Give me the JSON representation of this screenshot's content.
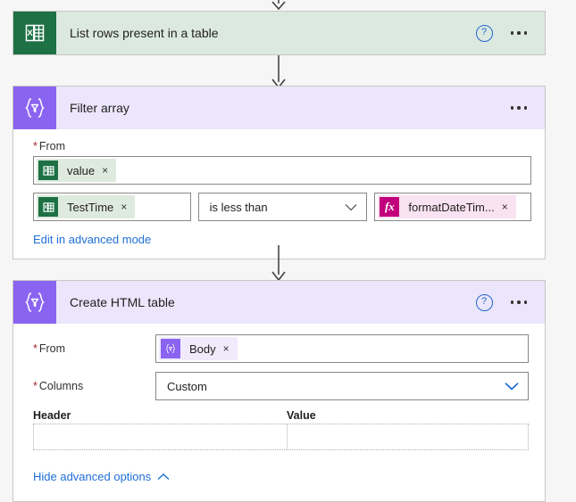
{
  "flow": {
    "connectors": [
      {
        "name": "connector-top"
      },
      {
        "name": "connector-excel-to-filter"
      },
      {
        "name": "connector-filter-to-table"
      }
    ],
    "steps": [
      {
        "id": "list-rows",
        "title": "List rows present in a table",
        "icon": "excel-icon",
        "theme": "green",
        "has_help": true,
        "has_menu": true
      },
      {
        "id": "filter-array",
        "title": "Filter array",
        "icon": "filter-array-icon",
        "theme": "purple",
        "has_help": false,
        "has_menu": true,
        "from_label": "From",
        "from_token": {
          "label": "value",
          "icon": "excel-icon",
          "remove": "×"
        },
        "condition": {
          "left_token": {
            "label": "TestTime",
            "icon": "excel-icon",
            "remove": "×"
          },
          "operator": "is less than",
          "right_token": {
            "label": "formatDateTim...",
            "icon": "function-icon",
            "remove": "×"
          }
        },
        "advanced_link": "Edit in advanced mode"
      },
      {
        "id": "create-html-table",
        "title": "Create HTML table",
        "icon": "create-html-table-icon",
        "theme": "purple",
        "has_help": true,
        "has_menu": true,
        "from_label": "From",
        "from_token": {
          "label": "Body",
          "icon": "filter-array-icon",
          "remove": "×"
        },
        "columns_label": "Columns",
        "columns_value": "Custom",
        "header_column_label": "Header",
        "value_column_label": "Value",
        "header_input_value": "",
        "value_input_value": "",
        "advanced_link": "Hide advanced options"
      }
    ]
  },
  "icons": {
    "help": "?",
    "ellipsis": "•••",
    "chevron_down": "chevron-down-icon",
    "chevron_up": "chevron-up-icon",
    "fx": "fx"
  },
  "colors": {
    "excel_green": "#1d7145",
    "excel_header_bg": "#dce9e1",
    "purple": "#8a64f0",
    "purple_header_bg": "#ebe6fb",
    "function_magenta": "#c1007c",
    "link_blue": "#1f6fd6",
    "required_red": "#a4262c",
    "canvas_bg": "#f6f6f6"
  }
}
